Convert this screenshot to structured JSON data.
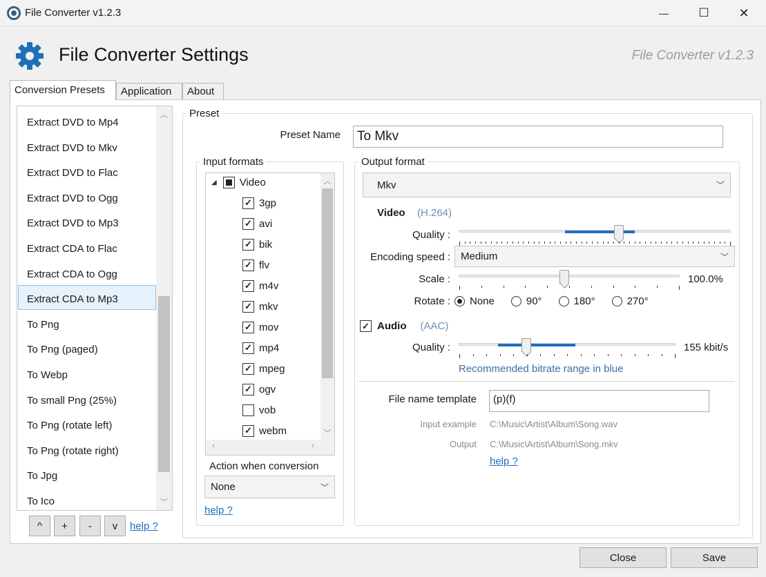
{
  "window": {
    "title": "File Converter v1.2.3",
    "controls": {
      "minimize": "—",
      "maximize": "☐",
      "close": "✕"
    }
  },
  "header": {
    "title": "File Converter Settings",
    "version": "File Converter v1.2.3",
    "icon": "gear-icon"
  },
  "tabs": [
    "Conversion Presets",
    "Application",
    "About"
  ],
  "presets": {
    "items": [
      "Extract DVD to Mp4",
      "Extract DVD to Mkv",
      "Extract DVD to Flac",
      "Extract DVD to Ogg",
      "Extract DVD to Mp3",
      "Extract CDA to Flac",
      "Extract CDA to Ogg",
      "Extract CDA to Mp3",
      "To Png",
      "To Png (paged)",
      "To Webp",
      "To small Png (25%)",
      "To Png (rotate left)",
      "To Png (rotate right)",
      "To Jpg",
      "To Ico"
    ],
    "selected": "Extract CDA to Mp3",
    "buttons": [
      "^",
      "+",
      "-",
      "v"
    ],
    "help": "help ?"
  },
  "preset": {
    "group_label": "Preset",
    "name_label": "Preset Name",
    "name_value": "To Mkv"
  },
  "input_formats": {
    "label": "Input formats",
    "category": "Video",
    "items": [
      {
        "name": "3gp",
        "checked": true
      },
      {
        "name": "avi",
        "checked": true
      },
      {
        "name": "bik",
        "checked": true
      },
      {
        "name": "flv",
        "checked": true
      },
      {
        "name": "m4v",
        "checked": true
      },
      {
        "name": "mkv",
        "checked": true
      },
      {
        "name": "mov",
        "checked": true
      },
      {
        "name": "mp4",
        "checked": true
      },
      {
        "name": "mpeg",
        "checked": true
      },
      {
        "name": "ogv",
        "checked": true
      },
      {
        "name": "vob",
        "checked": false
      },
      {
        "name": "webm",
        "checked": true
      }
    ],
    "action_label": "Action when conversion",
    "action_value": "None",
    "help": "help ?"
  },
  "output": {
    "label": "Output format",
    "format": "Mkv",
    "video": {
      "label": "Video",
      "codec": "(H.264)",
      "quality_label": "Quality :",
      "quality_value": 0.66,
      "encoding_speed_label": "Encoding speed :",
      "encoding_speed": "Medium",
      "scale_label": "Scale :",
      "scale_value": "100.0%",
      "rotate_label": "Rotate :",
      "rotate_options": [
        "None",
        "90°",
        "180°",
        "270°"
      ],
      "rotate_selected": "None"
    },
    "audio": {
      "label": "Audio",
      "enabled": true,
      "codec": "(AAC)",
      "quality_label": "Quality :",
      "quality_value": "155 kbit/s",
      "hint": "Recommended bitrate range in blue"
    },
    "file_template_label": "File name template",
    "file_template_value": "(p)(f)",
    "input_example_label": "Input example",
    "input_example_value": "C:\\Music\\Artist\\Album\\Song.wav",
    "output_label": "Output",
    "output_value": "C:\\Music\\Artist\\Album\\Song.mkv",
    "help": "help ?"
  },
  "footer": {
    "close": "Close",
    "save": "Save"
  },
  "colors": {
    "accent": "#1d6fc2",
    "selected_bg": "#e5f1fb",
    "gear": "#1f6fb8"
  }
}
